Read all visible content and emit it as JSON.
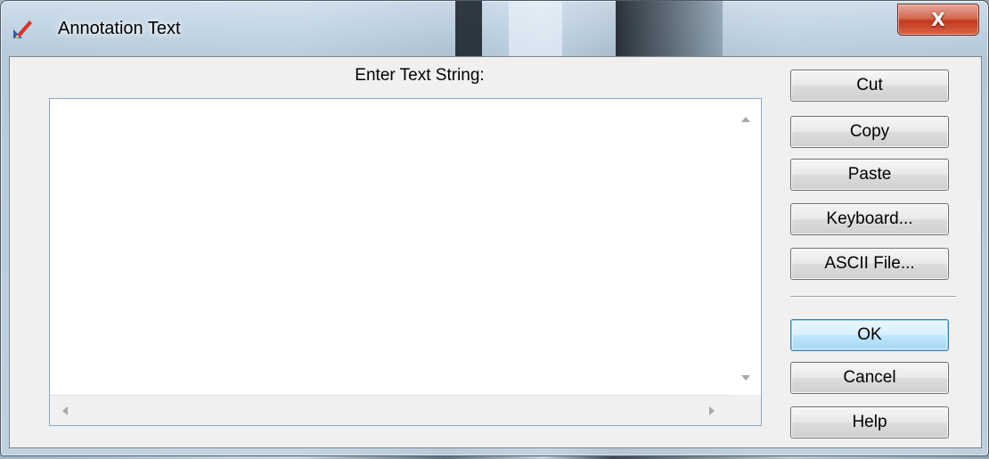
{
  "window": {
    "title": "Annotation Text",
    "close_glyph": "X"
  },
  "dialog": {
    "prompt": "Enter Text String:",
    "text_value": ""
  },
  "buttons": {
    "cut": "Cut",
    "copy": "Copy",
    "paste": "Paste",
    "keyboard": "Keyboard...",
    "ascii_file": "ASCII File...",
    "ok": "OK",
    "cancel": "Cancel",
    "help": "Help"
  },
  "icons": {
    "app": "annotation-pencil-icon",
    "close": "close-icon"
  },
  "colors": {
    "close_button": "#c2391b",
    "default_button_border": "#3c7fb1",
    "textarea_border": "#8da6c4"
  }
}
